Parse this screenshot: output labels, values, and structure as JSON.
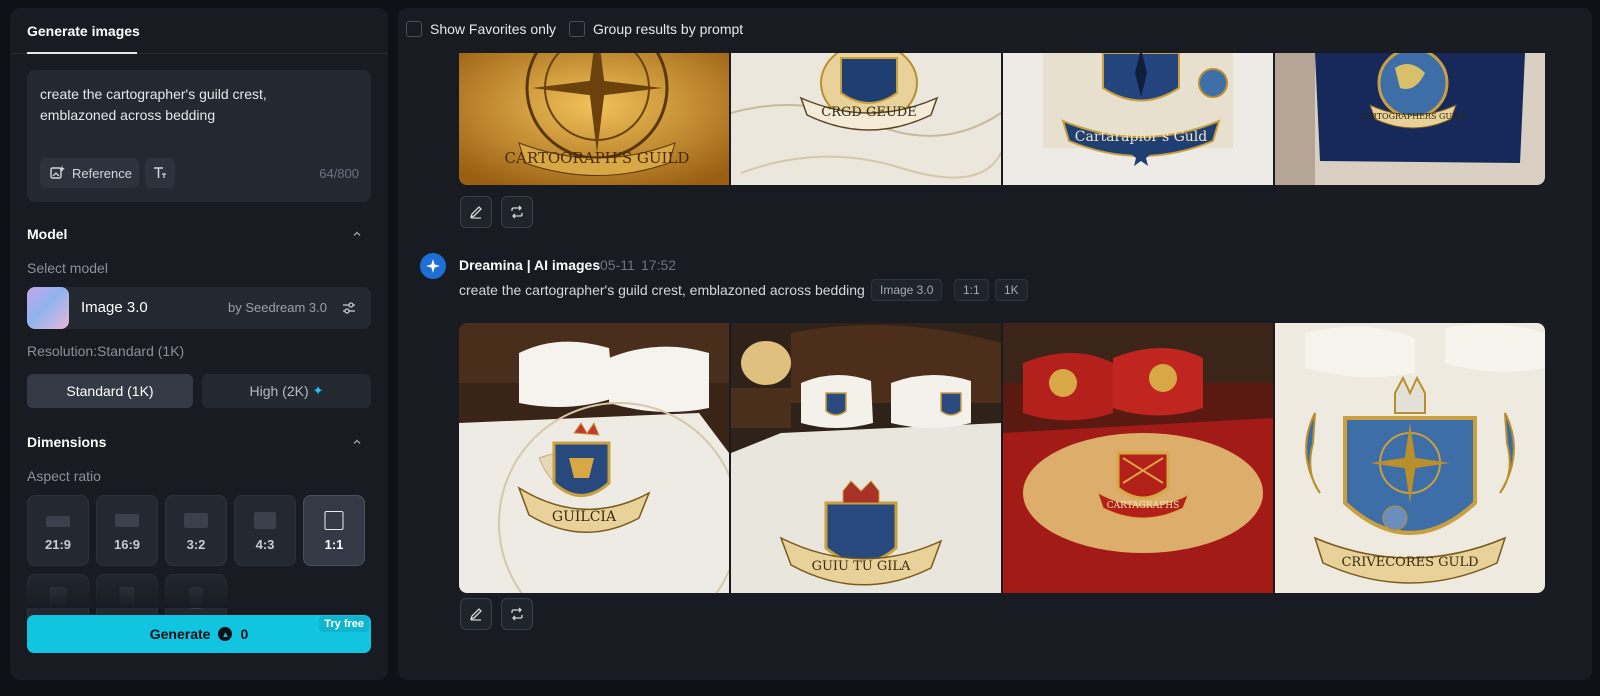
{
  "left_panel": {
    "tab_label": "Generate images",
    "prompt": {
      "text": "create the cartographer's guild crest, emblazoned across bedding",
      "reference_label": "Reference",
      "counter": "64/800"
    },
    "model": {
      "section_title": "Model",
      "select_label": "Select model",
      "name": "Image 3.0",
      "by": "by Seedream 3.0"
    },
    "resolution": {
      "label": "Resolution:Standard (1K)",
      "options": [
        "Standard (1K)",
        "High (2K)"
      ],
      "selected": "Standard (1K)"
    },
    "dimensions": {
      "section_title": "Dimensions",
      "aspect_label": "Aspect ratio",
      "ratios": [
        "21:9",
        "16:9",
        "3:2",
        "4:3",
        "1:1"
      ],
      "selected": "1:1"
    },
    "generate": {
      "label": "Generate",
      "cost": "0",
      "badge": "Try free"
    }
  },
  "right_panel": {
    "filters": {
      "favorites_label": "Show Favorites only",
      "group_label": "Group results by prompt"
    },
    "generation": {
      "author": "Dreamina | AI images",
      "date": "05-11",
      "time": "17:52",
      "prompt": "create the cartographer's guild crest, emblazoned across bedding",
      "tags": [
        "Image 3.0",
        "1:1",
        "1K"
      ]
    }
  },
  "colors": {
    "accent": "#11c5e0",
    "panel": "#181c22",
    "background": "#0e1116"
  }
}
